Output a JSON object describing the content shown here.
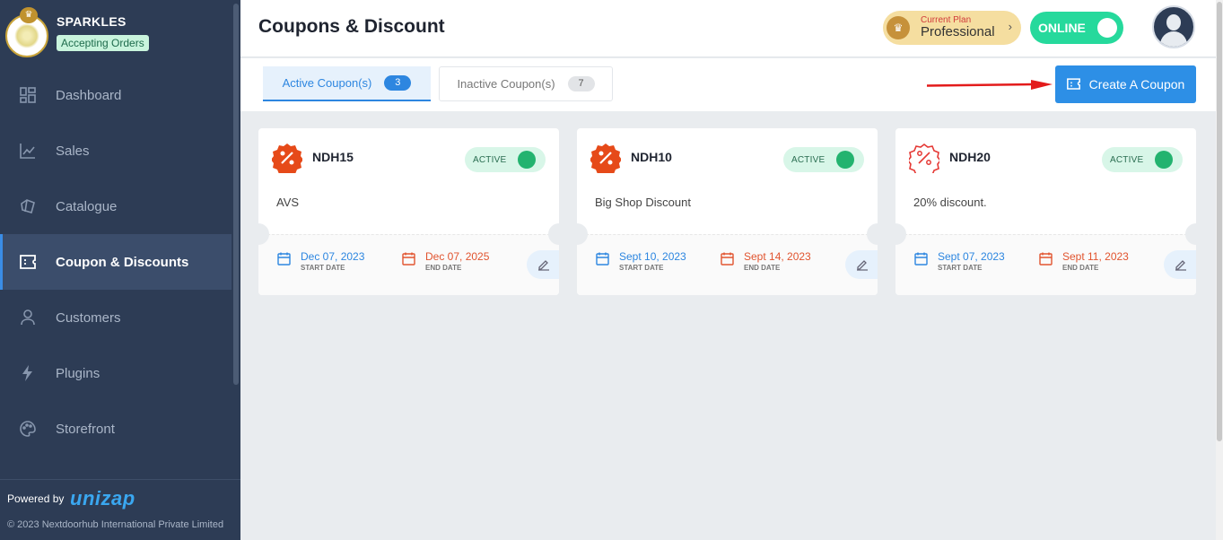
{
  "brand": {
    "name": "SPARKLES",
    "status": "Accepting Orders"
  },
  "sidebar": {
    "items": [
      {
        "label": "Dashboard",
        "icon": "dashboard-icon"
      },
      {
        "label": "Sales",
        "icon": "chart-line-icon"
      },
      {
        "label": "Catalogue",
        "icon": "catalogue-icon"
      },
      {
        "label": "Coupon & Discounts",
        "icon": "coupon-icon",
        "active": true
      },
      {
        "label": "Customers",
        "icon": "user-icon"
      },
      {
        "label": "Plugins",
        "icon": "lightning-icon"
      },
      {
        "label": "Storefront",
        "icon": "palette-icon"
      }
    ]
  },
  "footer": {
    "powered_by": "Powered by",
    "logo_text": "unizap",
    "copyright": "© 2023 Nextdoorhub International Private Limited"
  },
  "header": {
    "title": "Coupons & Discount",
    "plan_label": "Current Plan",
    "plan_name": "Professional",
    "status": "ONLINE"
  },
  "tabs": {
    "active": {
      "label": "Active Coupon(s)",
      "count": "3"
    },
    "inactive": {
      "label": "Inactive Coupon(s)",
      "count": "7"
    }
  },
  "create_button": {
    "label": "Create A Coupon"
  },
  "colors": {
    "sidebar_bg": "#2d3c55",
    "accent": "#2d86e0",
    "online": "#26d99c",
    "active_toggle": "#23b36f",
    "end_date": "#e1542f",
    "arrow": "#e31b1b"
  },
  "coupons": [
    {
      "code": "NDH15",
      "status": "ACTIVE",
      "description": "AVS",
      "start_date": "Dec 07, 2023",
      "start_label": "START DATE",
      "end_date": "Dec 07, 2025",
      "end_label": "END DATE",
      "icon": "percent-badge-filled-icon"
    },
    {
      "code": "NDH10",
      "status": "ACTIVE",
      "description": "Big Shop Discount",
      "start_date": "Sept 10, 2023",
      "start_label": "START DATE",
      "end_date": "Sept 14, 2023",
      "end_label": "END DATE",
      "icon": "percent-badge-filled-icon"
    },
    {
      "code": "NDH20",
      "status": "ACTIVE",
      "description": "20% discount.",
      "start_date": "Sept 07, 2023",
      "start_label": "START DATE",
      "end_date": "Sept 11, 2023",
      "end_label": "END DATE",
      "icon": "percent-badge-outline-icon"
    }
  ]
}
